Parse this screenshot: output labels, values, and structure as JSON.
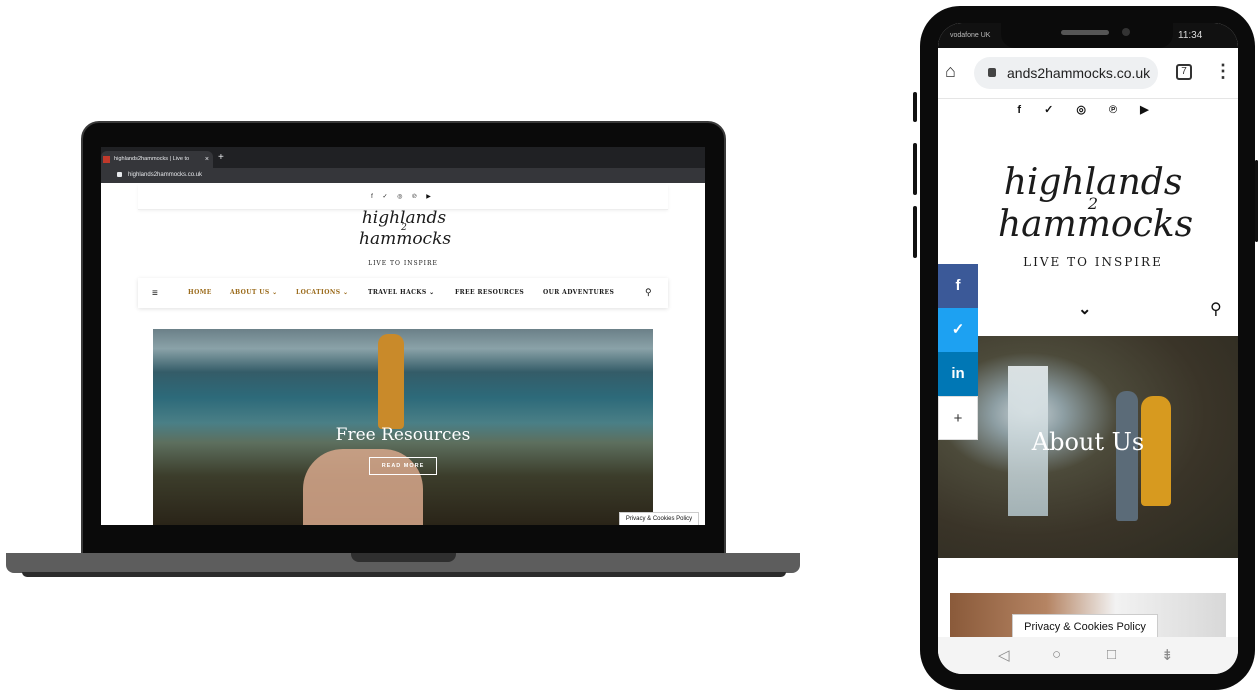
{
  "laptop": {
    "tab_title": "highlands2hammocks | Live to",
    "tab_close": "×",
    "new_tab": "+",
    "url": "highlands2hammocks.co.uk",
    "social_icons": [
      "facebook-icon",
      "twitter-icon",
      "instagram-icon",
      "pinterest-icon",
      "youtube-icon"
    ],
    "social_glyphs": "f ✓ ◎ ℗ ▶",
    "logo": {
      "line1": "highlands",
      "line2": "2",
      "line3": "hammocks"
    },
    "tagline": "LIVE TO INSPIRE",
    "nav": {
      "menu_glyph": "≡",
      "search_glyph": "⚲",
      "items": [
        {
          "label": "HOME"
        },
        {
          "label": "ABOUT US ⌄"
        },
        {
          "label": "LOCATIONS ⌄"
        },
        {
          "label": "TRAVEL HACKS ⌄"
        },
        {
          "label": "FREE RESOURCES"
        },
        {
          "label": "OUR ADVENTURES"
        }
      ]
    },
    "hero": {
      "title": "Free Resources",
      "button": "READ MORE"
    },
    "cookie": "Privacy & Cookies Policy"
  },
  "phone": {
    "carrier": "vodafone UK",
    "time": "11:34",
    "url": "ands2hammocks.co.uk",
    "tab_count": "7",
    "home_glyph": "⌂",
    "menu_glyph": "⋮",
    "social_glyphs": "f ✓ ◎ ℗ ▶",
    "logo": {
      "line1": "highlands",
      "line2": "2",
      "line3": "hammocks"
    },
    "tagline": "LIVE TO INSPIRE",
    "nav": {
      "chevron": "⌄",
      "search": "⚲"
    },
    "share": [
      {
        "label": "f",
        "color": "#3b5998"
      },
      {
        "label": "✓",
        "color": "#1da1f2"
      },
      {
        "label": "in",
        "color": "#0077b5"
      },
      {
        "label": "+",
        "color": "#ffffff"
      }
    ],
    "hero": {
      "title": "About Us"
    },
    "cookie": "Privacy & Cookies Policy",
    "system_nav": {
      "back": "◁",
      "home": "○",
      "recent": "□",
      "extra": "⇟"
    }
  },
  "colors": {
    "nav_gold": "#9a6a1a",
    "nav_dark": "#1a1a1a"
  }
}
